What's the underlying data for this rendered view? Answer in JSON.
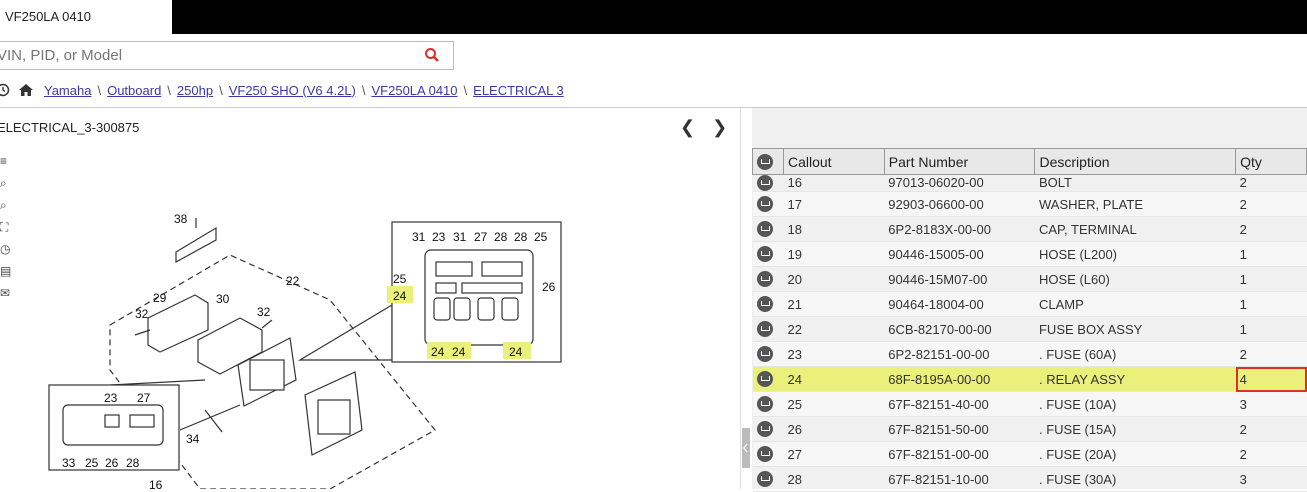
{
  "tab": {
    "label": "VF250LA 0410"
  },
  "search": {
    "placeholder": "VIN, PID, or Model"
  },
  "breadcrumb": [
    "Yamaha",
    "Outboard",
    "250hp",
    "VF250 SHO (V6 4.2L)",
    "VF250LA 0410",
    "ELECTRICAL 3"
  ],
  "diagram": {
    "title": "ELECTRICAL_3-300875"
  },
  "table": {
    "headers": [
      "Callout",
      "Part Number",
      "Description",
      "Qty"
    ],
    "rows": [
      {
        "callout": "16",
        "part": "97013-06020-00",
        "desc": "BOLT",
        "qty": "2"
      },
      {
        "callout": "17",
        "part": "92903-06600-00",
        "desc": "WASHER, PLATE",
        "qty": "2"
      },
      {
        "callout": "18",
        "part": "6P2-8183X-00-00",
        "desc": "CAP, TERMINAL",
        "qty": "2"
      },
      {
        "callout": "19",
        "part": "90446-15005-00",
        "desc": "HOSE (L200)",
        "qty": "1"
      },
      {
        "callout": "20",
        "part": "90446-15M07-00",
        "desc": "HOSE (L60)",
        "qty": "1"
      },
      {
        "callout": "21",
        "part": "90464-18004-00",
        "desc": "CLAMP",
        "qty": "1"
      },
      {
        "callout": "22",
        "part": "6CB-82170-00-00",
        "desc": "FUSE BOX ASSY",
        "qty": "1"
      },
      {
        "callout": "23",
        "part": "6P2-82151-00-00",
        "desc": ". FUSE (60A)",
        "qty": "2"
      },
      {
        "callout": "24",
        "part": "68F-8195A-00-00",
        "desc": ". RELAY ASSY",
        "qty": "4"
      },
      {
        "callout": "25",
        "part": "67F-82151-40-00",
        "desc": ". FUSE (10A)",
        "qty": "3"
      },
      {
        "callout": "26",
        "part": "67F-82151-50-00",
        "desc": ". FUSE (15A)",
        "qty": "2"
      },
      {
        "callout": "27",
        "part": "67F-82151-00-00",
        "desc": ". FUSE (20A)",
        "qty": "2"
      },
      {
        "callout": "28",
        "part": "67F-82151-10-00",
        "desc": ". FUSE (30A)",
        "qty": "3"
      }
    ]
  },
  "callouts": {
    "c38": "38",
    "c22": "22",
    "c29": "29",
    "c30": "30",
    "c32a": "32",
    "c32b": "32",
    "c34": "34",
    "c16": "16",
    "inset_top": [
      "31",
      "23",
      "31",
      "27",
      "28",
      "28",
      "25"
    ],
    "inset_25": "25",
    "inset_24": "24",
    "inset_26": "26",
    "inset_bottom": [
      "24",
      "24",
      "24"
    ],
    "small_top": [
      "23",
      "27"
    ],
    "small_bottom": [
      "33",
      "25",
      "26",
      "28"
    ]
  },
  "icons": {
    "search": "search-icon",
    "home": "home-icon",
    "history": "history-icon",
    "cart": "cart-icon",
    "prev": "chevron-left-icon",
    "next": "chevron-right-icon"
  },
  "colors": {
    "highlight": "#eaf07a",
    "qty_outline": "#d9302b",
    "link": "#3a3aa8"
  }
}
